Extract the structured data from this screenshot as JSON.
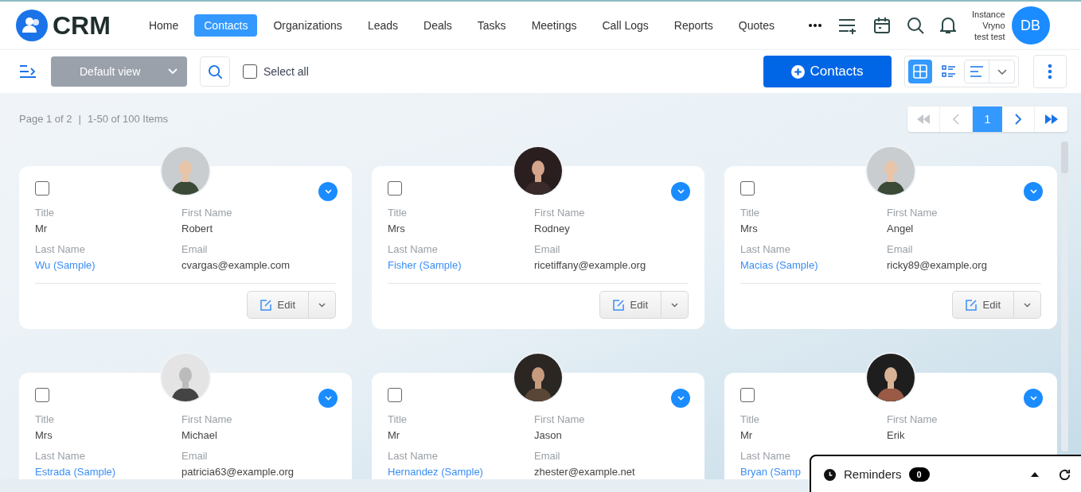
{
  "logo": {
    "text": "CRM"
  },
  "nav": [
    {
      "label": "Home",
      "selected": false
    },
    {
      "label": "Contacts",
      "selected": true
    },
    {
      "label": "Organizations",
      "selected": false
    },
    {
      "label": "Leads",
      "selected": false
    },
    {
      "label": "Deals",
      "selected": false
    },
    {
      "label": "Tasks",
      "selected": false
    },
    {
      "label": "Meetings",
      "selected": false
    },
    {
      "label": "Call Logs",
      "selected": false
    },
    {
      "label": "Reports",
      "selected": false
    },
    {
      "label": "Quotes",
      "selected": false
    }
  ],
  "user": {
    "lines": [
      "Instance",
      "Vryno",
      "test test"
    ],
    "initials": "DB"
  },
  "toolbar": {
    "view": "Default view",
    "select_all": {
      "label": "Select all",
      "checked": false
    },
    "add_button": "Contacts",
    "view_modes": [
      {
        "kind": "grid",
        "selected": true
      },
      {
        "kind": "list",
        "selected": false
      }
    ]
  },
  "pagination": {
    "summary": "Page 1 of 2",
    "separator": "|",
    "range": "1-50 of 100 Items",
    "pages": [
      {
        "label": "1",
        "selected": true
      }
    ]
  },
  "cards": [
    {
      "checked": false,
      "fields": [
        {
          "label": "Title",
          "value": "Mr"
        },
        {
          "label": "First Name",
          "value": "Robert"
        },
        {
          "label": "Last Name",
          "value": "Wu (Sample)",
          "kind": "link"
        },
        {
          "label": "Email",
          "value": "cvargas@example.com"
        }
      ],
      "edit": "Edit"
    },
    {
      "checked": false,
      "fields": [
        {
          "label": "Title",
          "value": "Mrs"
        },
        {
          "label": "First Name",
          "value": "Rodney"
        },
        {
          "label": "Last Name",
          "value": "Fisher (Sample)",
          "kind": "link"
        },
        {
          "label": "Email",
          "value": "ricetiffany@example.org"
        }
      ],
      "edit": "Edit"
    },
    {
      "checked": false,
      "fields": [
        {
          "label": "Title",
          "value": "Mrs"
        },
        {
          "label": "First Name",
          "value": "Angel"
        },
        {
          "label": "Last Name",
          "value": "Macias (Sample)",
          "kind": "link"
        },
        {
          "label": "Email",
          "value": "ricky89@example.org"
        }
      ],
      "edit": "Edit"
    },
    {
      "checked": false,
      "fields": [
        {
          "label": "Title",
          "value": "Mrs"
        },
        {
          "label": "First Name",
          "value": "Michael"
        },
        {
          "label": "Last Name",
          "value": "Estrada (Sample)",
          "kind": "link"
        },
        {
          "label": "Email",
          "value": "patricia63@example.org"
        }
      ]
    },
    {
      "checked": false,
      "fields": [
        {
          "label": "Title",
          "value": "Mr"
        },
        {
          "label": "First Name",
          "value": "Jason"
        },
        {
          "label": "Last Name",
          "value": "Hernandez (Sample)",
          "kind": "link"
        },
        {
          "label": "Email",
          "value": "zhester@example.net"
        }
      ]
    },
    {
      "checked": false,
      "fields": [
        {
          "label": "Title",
          "value": "Mr"
        },
        {
          "label": "First Name",
          "value": "Erik"
        },
        {
          "label": "Last Name",
          "value": "Bryan (Samp",
          "kind": "link"
        }
      ]
    }
  ],
  "reminders": {
    "label": "Reminders",
    "count": "0"
  }
}
